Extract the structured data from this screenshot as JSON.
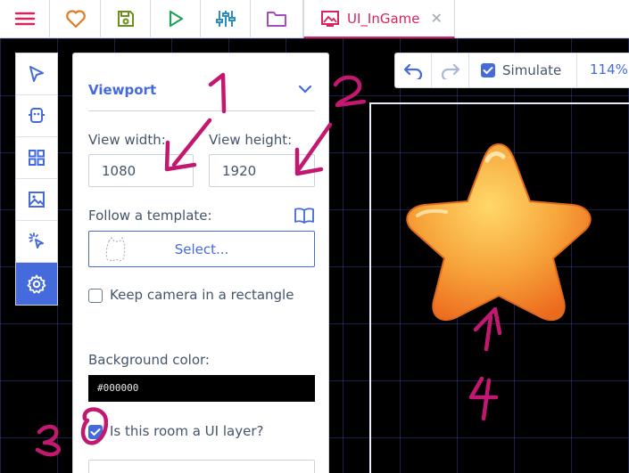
{
  "topbar": {
    "buttons": [
      {
        "name": "menu-icon",
        "color": "#d8245a"
      },
      {
        "name": "heart-icon",
        "color": "#e07b1f"
      },
      {
        "name": "save-icon",
        "color": "#6b8f1e"
      },
      {
        "name": "play-icon",
        "color": "#22a05a"
      },
      {
        "name": "sliders-icon",
        "color": "#2a8fc0"
      },
      {
        "name": "folder-icon",
        "color": "#a14dc4"
      }
    ],
    "active_tab": {
      "label": "UI_InGame",
      "close": "✕",
      "icon": "room-icon"
    }
  },
  "tools": [
    {
      "name": "select-tool-icon",
      "active": false
    },
    {
      "name": "robot-tool-icon",
      "active": false
    },
    {
      "name": "tiles-tool-icon",
      "active": false
    },
    {
      "name": "image-tool-icon",
      "active": false
    },
    {
      "name": "click-tool-icon",
      "active": false
    },
    {
      "name": "settings-tool-icon",
      "active": true
    }
  ],
  "panel": {
    "section_title": "Viewport",
    "view_width_label": "View width:",
    "view_width_value": "1080",
    "view_height_label": "View height:",
    "view_height_value": "1920",
    "template_label": "Follow a template:",
    "template_button": "Select...",
    "keep_camera_label": "Keep camera in a rectangle",
    "keep_camera_checked": false,
    "background_color_label": "Background color:",
    "background_color_value": "#000000",
    "ui_layer_label": "Is this room a UI layer?",
    "ui_layer_checked": true
  },
  "viewport_toolbar": {
    "simulate_label": "Simulate",
    "simulate_checked": true,
    "zoom": "114%"
  },
  "annotations": {
    "marks": [
      "1",
      "2",
      "3",
      "4"
    ],
    "color": "#c2186f"
  },
  "colors": {
    "accent": "#446adb",
    "brand": "#d8245a"
  }
}
